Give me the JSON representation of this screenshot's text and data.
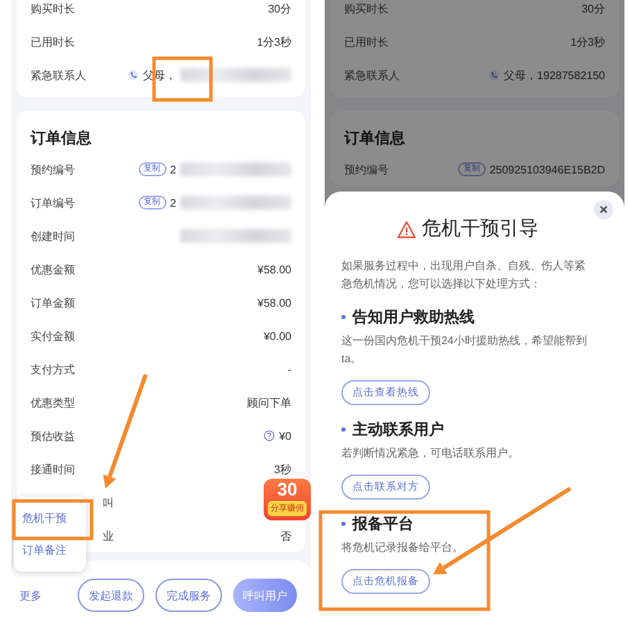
{
  "left_screen": {
    "service_card": {
      "rows": [
        {
          "label": "购买时长",
          "kind": "text",
          "value": "30分"
        },
        {
          "label": "已用时长",
          "kind": "text",
          "value": "1分3秒"
        },
        {
          "label": "紧急联系人",
          "kind": "contact",
          "value": "父母，",
          "redacted": true
        }
      ]
    },
    "order_card": {
      "title": "订单信息",
      "rows": [
        {
          "label": "预约编号",
          "kind": "copy",
          "copy_label": "复制",
          "value": "2",
          "redacted": true
        },
        {
          "label": "订单编号",
          "kind": "copy",
          "copy_label": "复制",
          "value": "2",
          "redacted": true
        },
        {
          "label": "创建时间",
          "kind": "blank",
          "redacted": true
        },
        {
          "label": "优惠金额",
          "kind": "text",
          "value": "¥58.00"
        },
        {
          "label": "订单金额",
          "kind": "text",
          "value": "¥58.00"
        },
        {
          "label": "实付金额",
          "kind": "text",
          "value": "¥0.00"
        },
        {
          "label": "支付方式",
          "kind": "text",
          "value": "-"
        },
        {
          "label": "优惠类型",
          "kind": "text",
          "value": "顾问下单"
        },
        {
          "label": "预估收益",
          "kind": "help",
          "value": "¥0"
        },
        {
          "label": "接通时间",
          "kind": "text",
          "value": "3秒"
        },
        {
          "label": "叫",
          "kind": "covered"
        },
        {
          "label": "业",
          "kind": "covered",
          "value": "否"
        }
      ]
    },
    "promo_badge": {
      "amount": "30",
      "caption": "分享赚佣"
    },
    "more_menu": {
      "items": [
        {
          "label": "危机干预"
        },
        {
          "label": "订单备注"
        }
      ]
    },
    "bottom_bar": {
      "more": "更多",
      "buttons": [
        {
          "label": "发起退款",
          "kind": "outline"
        },
        {
          "label": "完成服务",
          "kind": "outline"
        },
        {
          "label": "呼叫用户",
          "kind": "primary"
        }
      ]
    }
  },
  "right_screen": {
    "service_card": {
      "rows": [
        {
          "label": "购买时长",
          "kind": "text",
          "value": "30分"
        },
        {
          "label": "已用时长",
          "kind": "text",
          "value": "1分3秒"
        },
        {
          "label": "紧急联系人",
          "kind": "contact",
          "value": "父母，19287582150"
        }
      ]
    },
    "order_card": {
      "title": "订单信息",
      "rows": [
        {
          "label": "预约编号",
          "kind": "copy",
          "copy_label": "复制",
          "value": "250925103946E15B2D"
        }
      ]
    },
    "dialog": {
      "title": "危机干预引导",
      "intro": "如果服务过程中，出现用户自杀、自残、伤人等紧急危机情况，您可以选择以下处理方式：",
      "sections": [
        {
          "heading": "告知用户救助热线",
          "description": "这一份国内危机干预24小时援助热线，希望能帮到ta。",
          "button": "点击查看热线"
        },
        {
          "heading": "主动联系用户",
          "description": "若判断情况紧急，可电话联系用户。",
          "button": "点击联系对方"
        },
        {
          "heading": "报备平台",
          "description": "将危机记录报备给平台。",
          "button": "点击危机报备"
        }
      ]
    }
  }
}
